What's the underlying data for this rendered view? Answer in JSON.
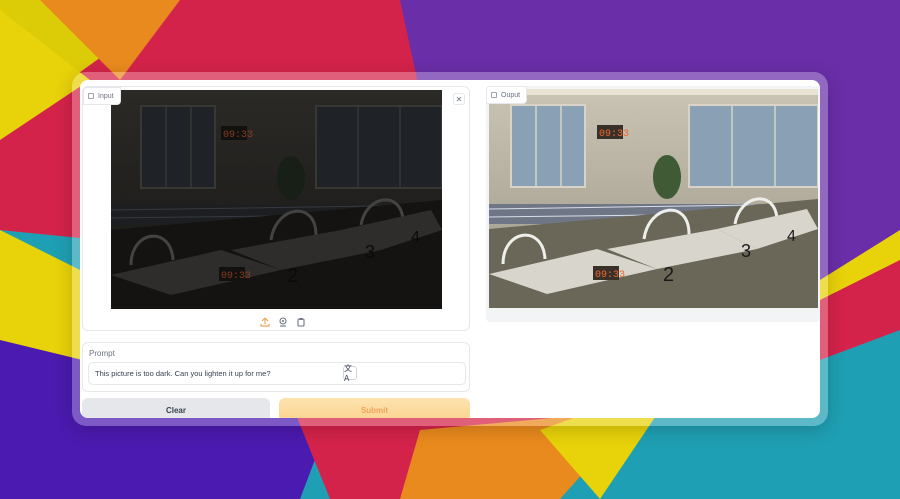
{
  "input_panel": {
    "label": "Input",
    "close_symbol": "✕"
  },
  "output_panel": {
    "label": "Ouput"
  },
  "photo": {
    "clock_top": "09:33",
    "clock_bottom": "09:33",
    "block_numbers": [
      "2",
      "3",
      "4"
    ]
  },
  "tools": [
    {
      "icon": "upload-icon"
    },
    {
      "icon": "webcam-icon"
    },
    {
      "icon": "clipboard-icon"
    }
  ],
  "prompt": {
    "label": "Prompt",
    "value": "This picture is too dark. Can you lighten it up for me?",
    "translate_symbol": "文A"
  },
  "buttons": {
    "clear": "Clear",
    "submit": "Submit"
  },
  "colors": {
    "accent": "#f2a35e",
    "submit_bg": "#fbd38d"
  }
}
